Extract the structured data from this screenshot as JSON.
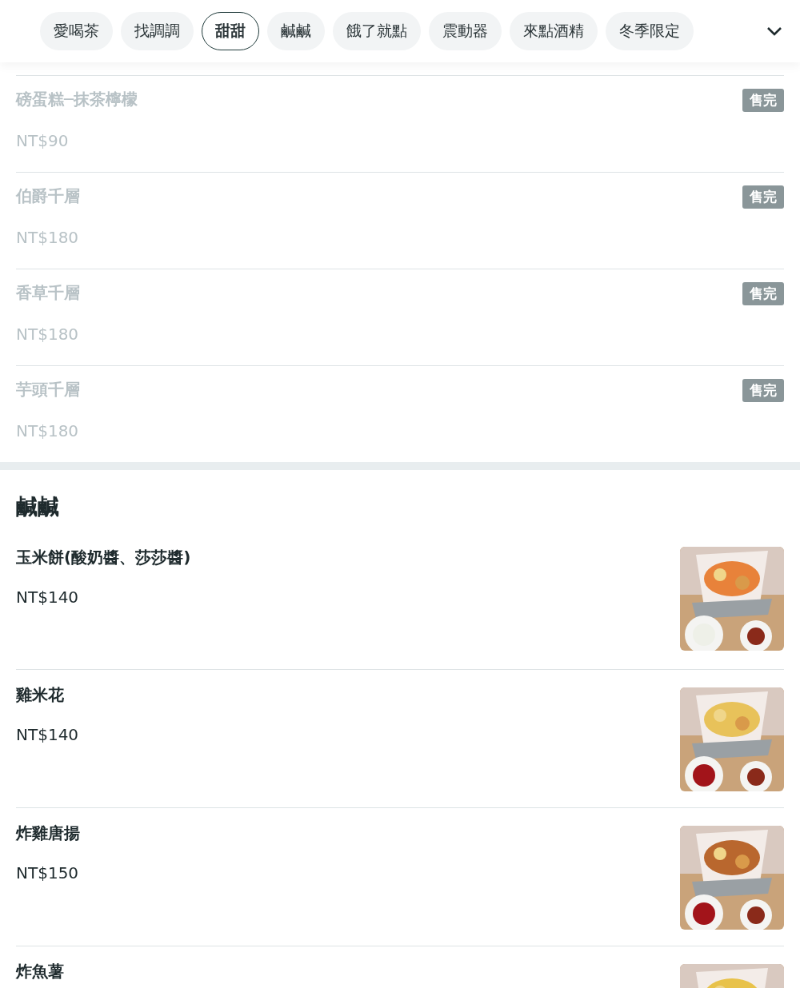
{
  "chips": [
    {
      "label": "愛喝茶",
      "selected": false
    },
    {
      "label": "找調調",
      "selected": false
    },
    {
      "label": "甜甜",
      "selected": true
    },
    {
      "label": "鹹鹹",
      "selected": false
    },
    {
      "label": "餓了就點",
      "selected": false
    },
    {
      "label": "震動器",
      "selected": false
    },
    {
      "label": "來點酒精",
      "selected": false
    },
    {
      "label": "冬季限定",
      "selected": false
    }
  ],
  "sections": [
    {
      "items": [
        {
          "name": "磅蛋糕─抹茶檸檬",
          "price": "NT$90",
          "sold_out": true,
          "badge": "售完"
        },
        {
          "name": "伯爵千層",
          "price": "NT$180",
          "sold_out": true,
          "badge": "售完"
        },
        {
          "name": "香草千層",
          "price": "NT$180",
          "sold_out": true,
          "badge": "售完"
        },
        {
          "name": "芋頭千層",
          "price": "NT$180",
          "sold_out": true,
          "badge": "售完"
        }
      ]
    },
    {
      "title": "鹹鹹",
      "items": [
        {
          "name": "玉米餅(酸奶醬、莎莎醬)",
          "price": "NT$140",
          "sold_out": false
        },
        {
          "name": "雞米花",
          "price": "NT$140",
          "sold_out": false
        },
        {
          "name": "炸雞唐揚",
          "price": "NT$150",
          "sold_out": false
        },
        {
          "name": "炸魚薯",
          "sold_out": false
        }
      ]
    }
  ]
}
